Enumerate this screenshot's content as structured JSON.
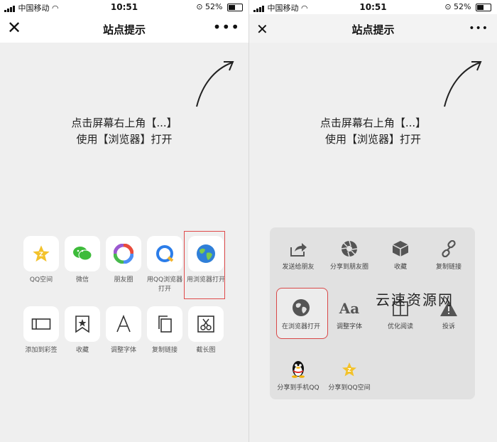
{
  "status": {
    "carrier": "中国移动",
    "time": "10:51",
    "battery": "52%"
  },
  "nav": {
    "title": "站点提示",
    "close_glyph": "✕",
    "more_glyph": "•••"
  },
  "hint": {
    "line1": "点击屏幕右上角【...】",
    "line2": "使用【浏览器】打开"
  },
  "left_share": {
    "row1": [
      {
        "label": "QQ空间",
        "icon": "qzone-star-icon"
      },
      {
        "label": "微信",
        "icon": "wechat-icon"
      },
      {
        "label": "朋友圈",
        "icon": "moments-icon"
      },
      {
        "label": "用QQ浏览器打开",
        "icon": "qq-browser-icon"
      },
      {
        "label": "用浏览器打开",
        "icon": "globe-icon"
      }
    ],
    "row2": [
      {
        "label": "添加到彩签",
        "icon": "tag-icon"
      },
      {
        "label": "收藏",
        "icon": "bookmark-star-icon"
      },
      {
        "label": "调整字体",
        "icon": "font-a-icon"
      },
      {
        "label": "复制链接",
        "icon": "copy-icon"
      },
      {
        "label": "截长图",
        "icon": "scissors-icon"
      }
    ]
  },
  "right_sheet": {
    "row1": [
      {
        "label": "发送给朋友",
        "icon": "share-forward-icon"
      },
      {
        "label": "分享到朋友圈",
        "icon": "aperture-icon"
      },
      {
        "label": "收藏",
        "icon": "cube-icon"
      },
      {
        "label": "复制链接",
        "icon": "link-icon"
      }
    ],
    "row2": [
      {
        "label": "在浏览器打开",
        "icon": "globe-icon"
      },
      {
        "label": "调整字体",
        "icon": "font-aa-icon"
      },
      {
        "label": "优化阅读",
        "icon": "book-icon"
      },
      {
        "label": "投诉",
        "icon": "warning-icon"
      }
    ],
    "row3": [
      {
        "label": "分享到手机QQ",
        "icon": "qq-penguin-icon"
      },
      {
        "label": "分享到QQ空间",
        "icon": "qzone-star-icon"
      }
    ]
  },
  "watermark": "云速资源网",
  "colors": {
    "highlight": "#e04b4b",
    "wechat_green": "#3dbb3a",
    "qzone_yellow": "#f3c22b"
  }
}
